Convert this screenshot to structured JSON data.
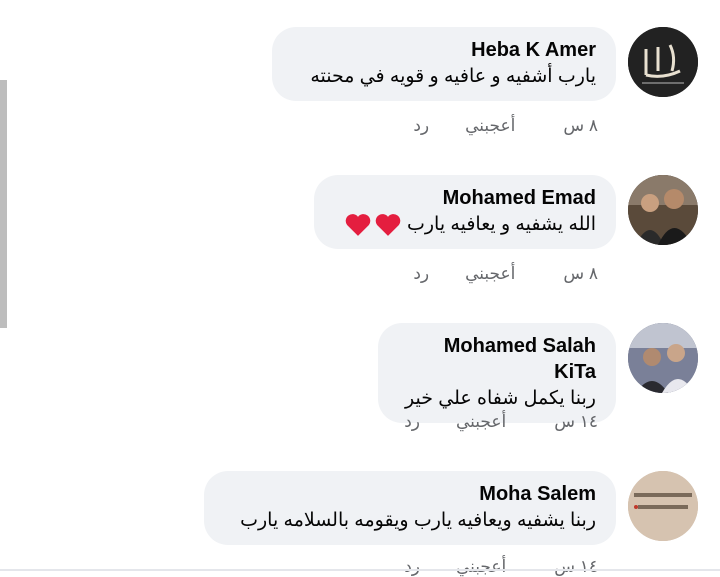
{
  "comments": [
    {
      "author": "Heba K Amer",
      "text": "يارب أشفيه و عافيه و قويه في محنته",
      "time": "٨ س",
      "like": "أعجبني",
      "reply": "رد",
      "avatar_icon": "calligraphy-avatar"
    },
    {
      "author": "Mohamed Emad",
      "text": "الله يشفيه و يعافيه يارب",
      "emoji": "red-heart-icon x2",
      "time": "٨ س",
      "like": "أعجبني",
      "reply": "رد",
      "avatar_icon": "two-people-photo-avatar"
    },
    {
      "author": "Mohamed Salah KiTa",
      "text": "ربنا يكمل شفاه علي خير",
      "time": "١٤ س",
      "like": "أعجبني",
      "reply": "رد",
      "avatar_icon": "two-people-photo-avatar"
    },
    {
      "author": "Moha Salem",
      "text": "ربنا يشفيه ويعافيه يارب ويقومه بالسلامه يارب",
      "time": "١٤ س",
      "like": "أعجبني",
      "reply": "رد",
      "avatar_icon": "text-card-avatar"
    }
  ],
  "colors": {
    "bubble": "#f0f2f5",
    "meta_text": "#65676b",
    "heart": "#e41e3f"
  }
}
